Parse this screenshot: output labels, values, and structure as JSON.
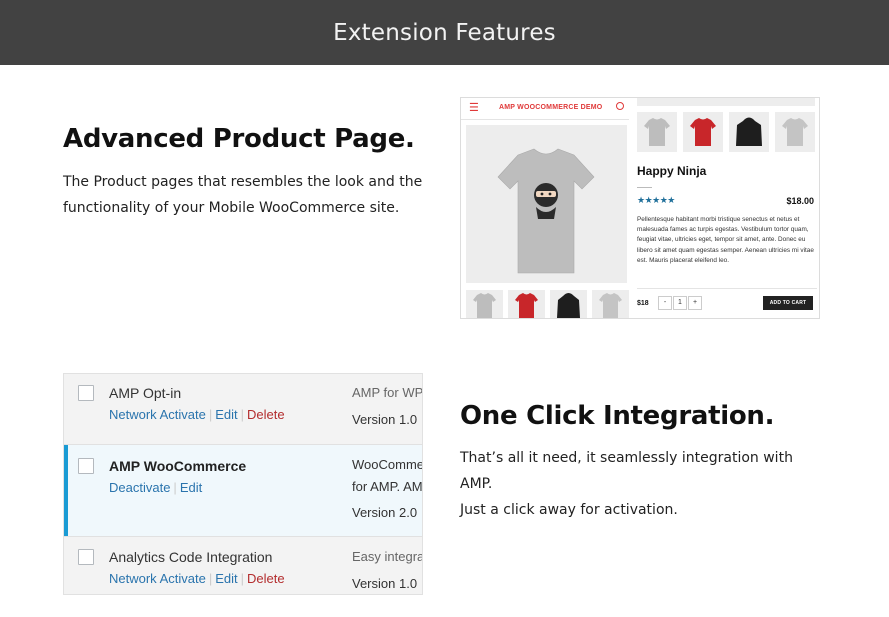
{
  "header": {
    "title": "Extension Features"
  },
  "feature1": {
    "title": "Advanced Product Page.",
    "lines": [
      "The Product pages that resembles the look and the",
      "functionality of your Mobile WooCommerce site."
    ]
  },
  "product_mock": {
    "brand": "AMP WOOCOMMERCE DEMO",
    "product_name": "Happy Ninja",
    "stars": "★★★★★",
    "price": "$18.00",
    "description": "Pellentesque habitant morbi tristique senectus et netus et malesuada fames ac turpis egestas. Vestibulum tortor quam, feugiat vitae, ultricies eget, tempor sit amet, ante. Donec eu libero sit amet quam egestas semper. Aenean ultricies mi vitae est. Mauris placerat eleifend leo.",
    "bottom_price": "$18",
    "qty_minus": "-",
    "qty_value": "1",
    "qty_plus": "+",
    "add_to_cart": "ADD TO CART",
    "thumb_colors": [
      "#bdbdbd",
      "#c8262a",
      "#1e1e1e",
      "#c4c4c4"
    ]
  },
  "plugins": [
    {
      "name": "AMP Opt-in",
      "actions": [
        "Network Activate",
        "Edit",
        "Delete"
      ],
      "desc": "AMP for WP",
      "version": "Version 1.0",
      "active": false
    },
    {
      "name": "AMP WooCommerce",
      "actions": [
        "Deactivate",
        "Edit"
      ],
      "desc_lines": [
        "WooCommerce",
        "for AMP. AMP"
      ],
      "version": "Version 2.0",
      "active": true
    },
    {
      "name": "Analytics Code Integration",
      "actions": [
        "Network Activate",
        "Edit",
        "Delete"
      ],
      "desc": "Easy integra",
      "version": "Version 1.0",
      "active": false
    }
  ],
  "feature2": {
    "title": "One Click Integration.",
    "lines": [
      "That’s all it need, it seamlessly integration with",
      "AMP.",
      "Just a click away for activation."
    ]
  },
  "colors": {
    "header_bg": "#424242",
    "active_border": "#1a9bd4",
    "link": "#2a74ad",
    "delete": "#b32d2e",
    "brand_red": "#e03a3a"
  }
}
